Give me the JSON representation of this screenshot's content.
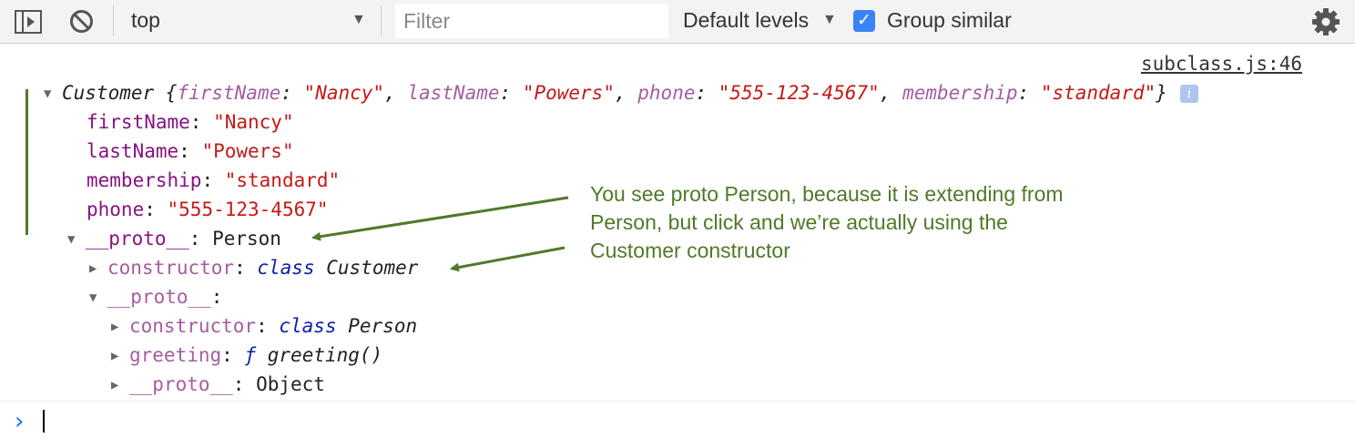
{
  "toolbar": {
    "context": "top",
    "filter_placeholder": "Filter",
    "levels": "Default levels",
    "group_similar": "Group similar",
    "group_similar_checked": true,
    "checkbox_color": "#3b82f6"
  },
  "console": {
    "source_link": "subclass.js:46",
    "object": {
      "name": "Customer",
      "preview": [
        {
          "key": "firstName",
          "value": "\"Nancy\""
        },
        {
          "key": "lastName",
          "value": "\"Powers\""
        },
        {
          "key": "phone",
          "value": "\"555-123-4567\""
        },
        {
          "key": "membership",
          "value": "\"standard\""
        }
      ],
      "properties": [
        {
          "key": "firstName",
          "value": "\"Nancy\""
        },
        {
          "key": "lastName",
          "value": "\"Powers\""
        },
        {
          "key": "membership",
          "value": "\"standard\""
        },
        {
          "key": "phone",
          "value": "\"555-123-4567\""
        }
      ],
      "proto_key": "__proto__",
      "proto_value": "Person",
      "constructor_key": "constructor",
      "constructor_keyword": "class",
      "constructor_name": "Customer",
      "inner_proto_key": "__proto__",
      "inner": [
        {
          "key": "constructor",
          "keyword": "class",
          "name": "Person"
        },
        {
          "key": "greeting",
          "keyword": "ƒ",
          "name": "greeting()"
        },
        {
          "key": "__proto__",
          "keyword": "",
          "name": "Object"
        }
      ]
    },
    "info_badge": "i"
  },
  "annotation": {
    "text": "You see proto Person, because it is extending from Person, but click and we’re actually using the Customer constructor",
    "color": "#4f7a28"
  },
  "icons": [
    "sidebar-toggle-icon",
    "clear-console-icon",
    "settings-gear-icon",
    "prompt-chevron-icon"
  ]
}
